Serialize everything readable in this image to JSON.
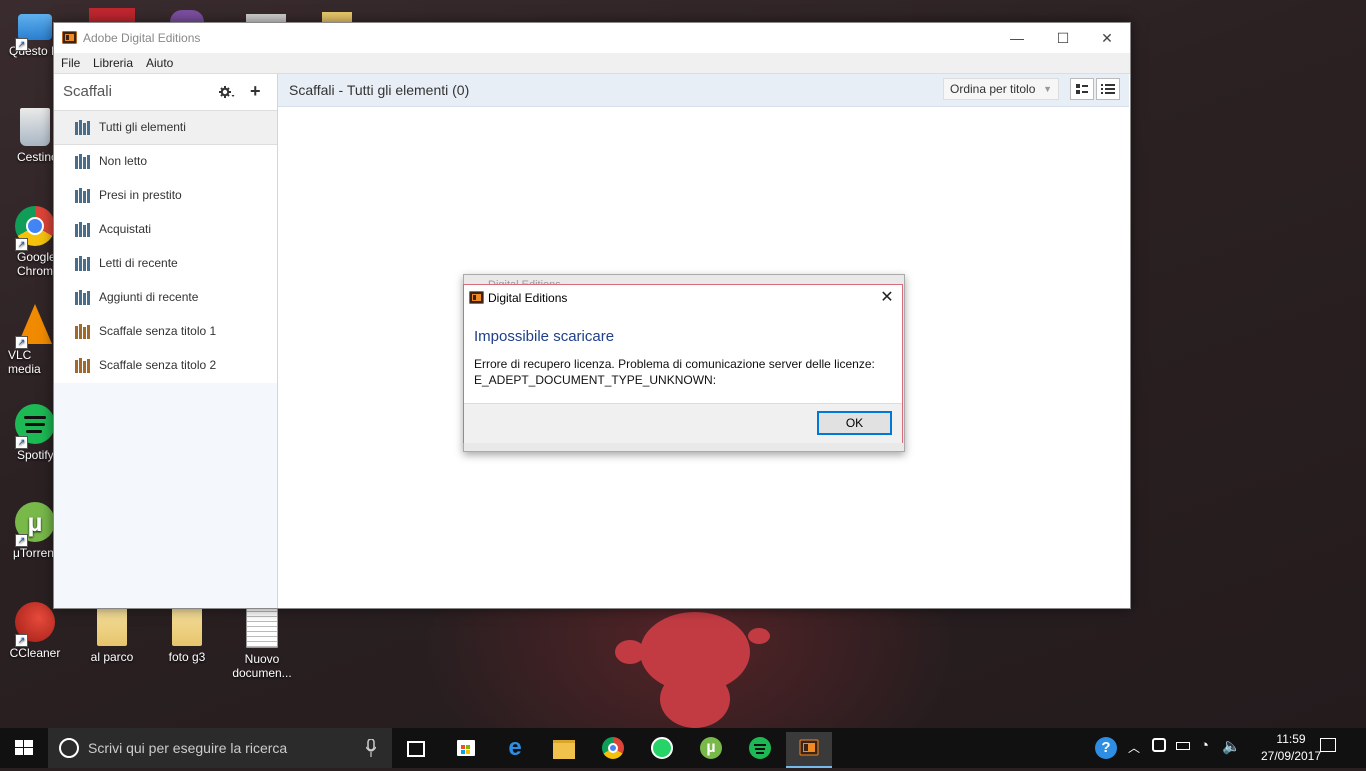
{
  "desktop": {
    "icons": [
      {
        "label": "Questo PC"
      },
      {
        "label": "Cestino"
      },
      {
        "label": "Google Chrome"
      },
      {
        "label": "VLC media player"
      },
      {
        "label": "Spotify"
      },
      {
        "label": "μTorrent"
      },
      {
        "label": "CCleaner"
      },
      {
        "label": "al parco"
      },
      {
        "label": "foto g3"
      },
      {
        "label": "Nuovo documen..."
      }
    ]
  },
  "window": {
    "title": "Adobe Digital Editions",
    "controls": {
      "minimize": "—",
      "maximize": "☐",
      "close": "✕"
    },
    "menu": [
      "File",
      "Libreria",
      "Aiuto"
    ]
  },
  "sidebar": {
    "title": "Scaffali",
    "gear_icon": "gear-icon",
    "add_icon": "+",
    "items": [
      {
        "label": "Tutti gli elementi",
        "active": true,
        "color": "#4a6e8a"
      },
      {
        "label": "Non letto",
        "color": "#4a6e8a"
      },
      {
        "label": "Presi in prestito",
        "color": "#4a6e8a"
      },
      {
        "label": "Acquistati",
        "color": "#4a6e8a"
      },
      {
        "label": "Letti di recente",
        "color": "#4a6e8a"
      },
      {
        "label": "Aggiunti di recente",
        "color": "#4a6e8a"
      },
      {
        "label": "Scaffale senza titolo 1",
        "color": "#a06a2c"
      },
      {
        "label": "Scaffale senza titolo 2",
        "color": "#a06a2c"
      }
    ]
  },
  "content": {
    "title": "Scaffali - Tutti gli elementi (0)",
    "sort": {
      "selected": "Ordina per titolo"
    }
  },
  "dialog": {
    "ghost_title": "Digital Editions",
    "title": "Digital Editions",
    "heading": "Impossibile scaricare",
    "message_line1": "Errore di recupero licenza. Problema di comunicazione server delle licenze:",
    "message_line2": "E_ADEPT_DOCUMENT_TYPE_UNKNOWN:",
    "ok_label": "OK",
    "close_glyph": "✕"
  },
  "taskbar": {
    "search_placeholder": "Scrivi qui per eseguire la ricerca",
    "apps": [
      "task-view",
      "store",
      "edge",
      "file-explorer",
      "chrome",
      "whatsapp",
      "utorrent",
      "spotify",
      "adobe-digital-editions"
    ],
    "clock_time": "11:59",
    "clock_date": "27/09/2017",
    "help_glyph": "?"
  },
  "colors": {
    "accent": "#0078d7",
    "dialog_border": "#d86a7a",
    "heading": "#1e3f8a"
  }
}
